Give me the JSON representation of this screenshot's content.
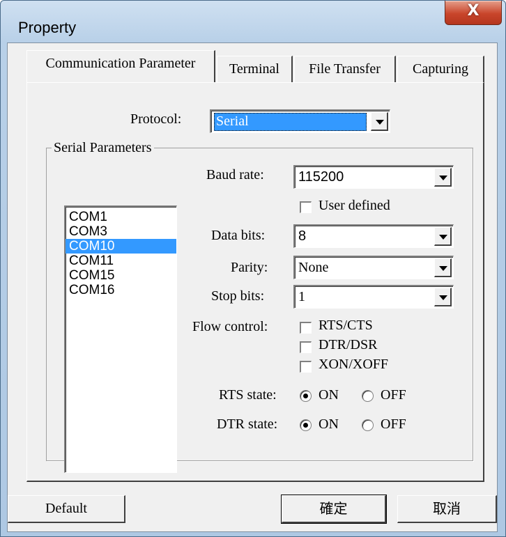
{
  "window": {
    "title": "Property",
    "close_glyph": "X"
  },
  "tabs": [
    "Communication Parameter",
    "Terminal",
    "File Transfer",
    "Capturing"
  ],
  "protocol": {
    "label": "Protocol:",
    "value": "Serial"
  },
  "serial": {
    "group_title": "Serial Parameters",
    "ports": [
      "COM1",
      "COM3",
      "COM10",
      "COM11",
      "COM15",
      "COM16"
    ],
    "selected_port": "COM10",
    "baud": {
      "label": "Baud rate:",
      "value": "115200"
    },
    "user_defined": {
      "label": "User defined",
      "checked": false
    },
    "data_bits": {
      "label": "Data bits:",
      "value": "8"
    },
    "parity": {
      "label": "Parity:",
      "value": "None"
    },
    "stop_bits": {
      "label": "Stop bits:",
      "value": "1"
    },
    "flow": {
      "label": "Flow control:",
      "options": [
        "RTS/CTS",
        "DTR/DSR",
        "XON/XOFF"
      ]
    },
    "rts": {
      "label": "RTS state:",
      "on": "ON",
      "off": "OFF",
      "value": "ON"
    },
    "dtr": {
      "label": "DTR state:",
      "on": "ON",
      "off": "OFF",
      "value": "ON"
    }
  },
  "buttons": {
    "default": "Default",
    "ok": "確定",
    "cancel": "取消"
  }
}
